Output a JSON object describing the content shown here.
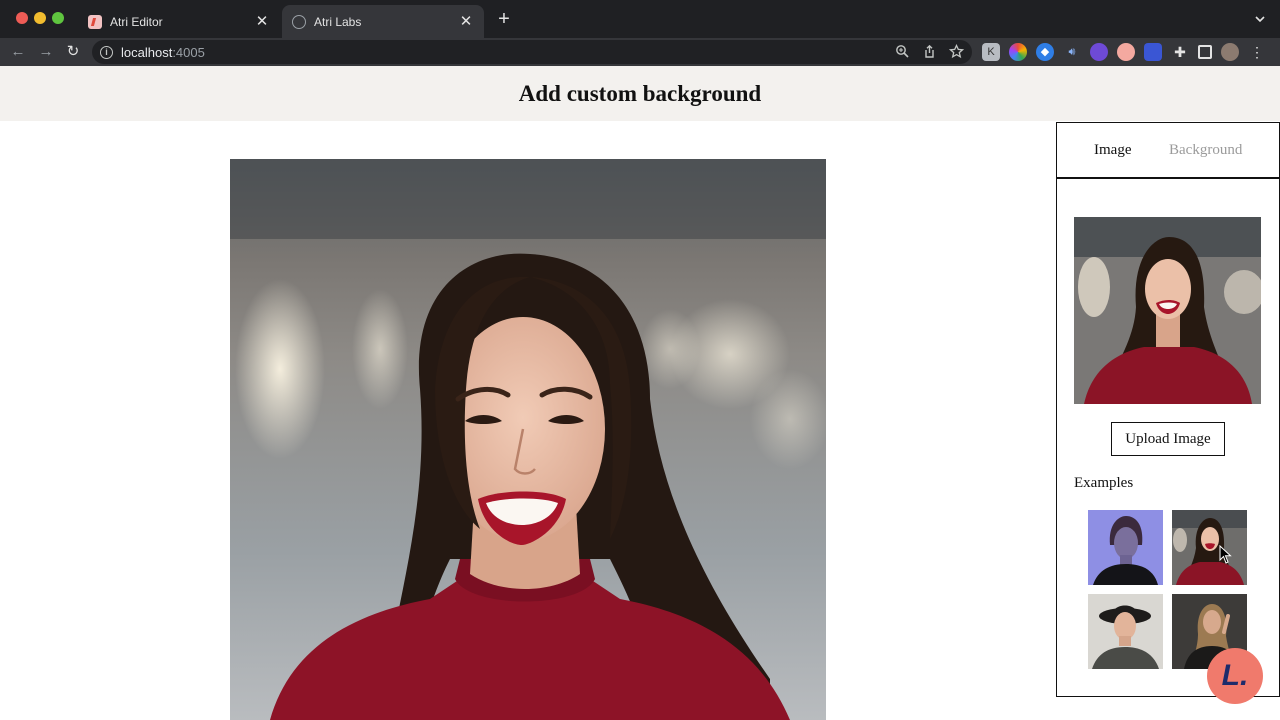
{
  "browser": {
    "tabs": [
      {
        "title": "Atri Editor",
        "active": false
      },
      {
        "title": "Atri Labs",
        "active": true
      }
    ],
    "url_host": "localhost",
    "url_port": ":4005"
  },
  "page": {
    "title": "Add custom background"
  },
  "panel": {
    "tabs": [
      "Image",
      "Background"
    ],
    "active_tab": "Image",
    "upload_label": "Upload Image",
    "examples_label": "Examples"
  },
  "fab": {
    "glyph": "L."
  },
  "colors": {
    "header_bg": "#f3f1ee",
    "fab_bg": "#f07a6c",
    "inactive_tab_text": "#9b9b9b"
  }
}
